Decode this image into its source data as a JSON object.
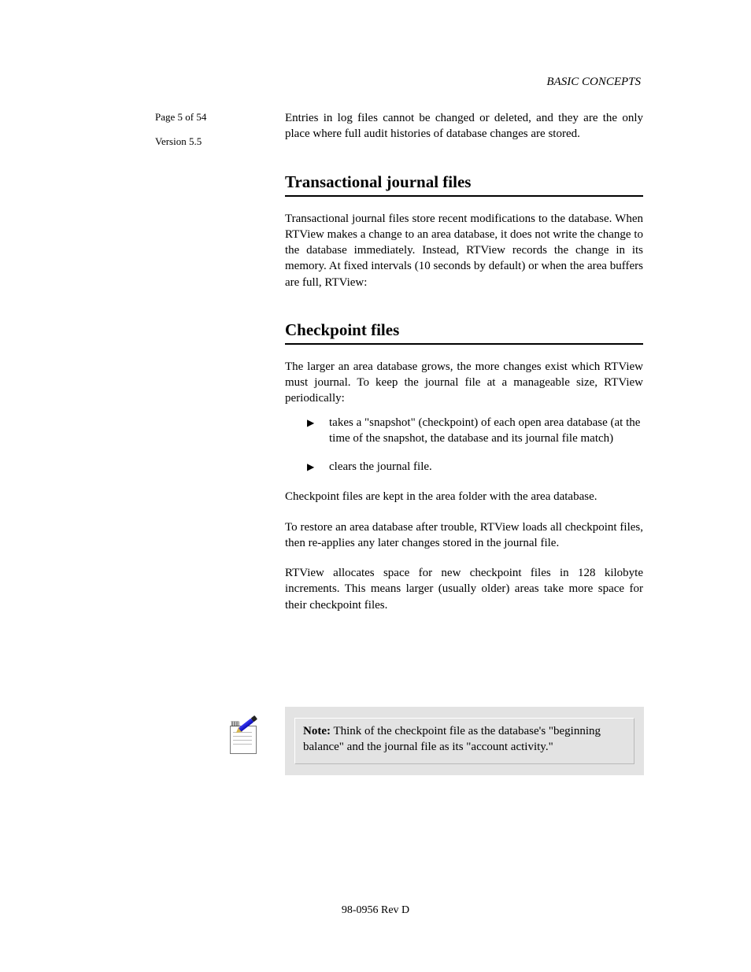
{
  "header": {
    "right": "BASIC CONCEPTS"
  },
  "sidebar": {
    "pagecount": "Page 5 of 54",
    "version": "Version 5.5"
  },
  "content": {
    "para_after_entries": "Entries in log files cannot be changed or deleted, and they are the only place where full audit histories of database changes are stored.",
    "heading_journal": "Transactional journal files",
    "journal_para": "Transactional journal files store recent modifications to the database. When RTView makes a change to an area database, it does not write the change to the database immediately. Instead, RTView records the change in its memory. At fixed intervals (10 seconds by default) or when the area buffers are full, RTView:",
    "heading_checkpoint": "Checkpoint files",
    "checkpoint_para_1": "The larger an area database grows, the more changes exist which RTView must journal. To keep the journal file at a manageable size, RTView periodically:",
    "checkpoint_bullets": [
      "takes a \"snapshot\" (checkpoint) of each open area database (at the time of the snapshot, the database and its journal file match)",
      "clears the journal file."
    ],
    "checkpoint_para_2": "Checkpoint files are kept in the area folder with the area database.",
    "checkpoint_para_3": "To restore an area database after trouble, RTView loads all checkpoint files, then re-applies any later changes stored in the journal file.",
    "checkpoint_para_4": "RTView allocates space for new checkpoint files in 128 kilobyte increments. This means larger (usually older) areas take more space for their checkpoint files.",
    "note": {
      "title": "Note:",
      "text": " Think of the checkpoint file as the database's \"beginning balance\" and the journal file as its \"account activity.\""
    }
  },
  "footer": "98-0956 Rev D"
}
